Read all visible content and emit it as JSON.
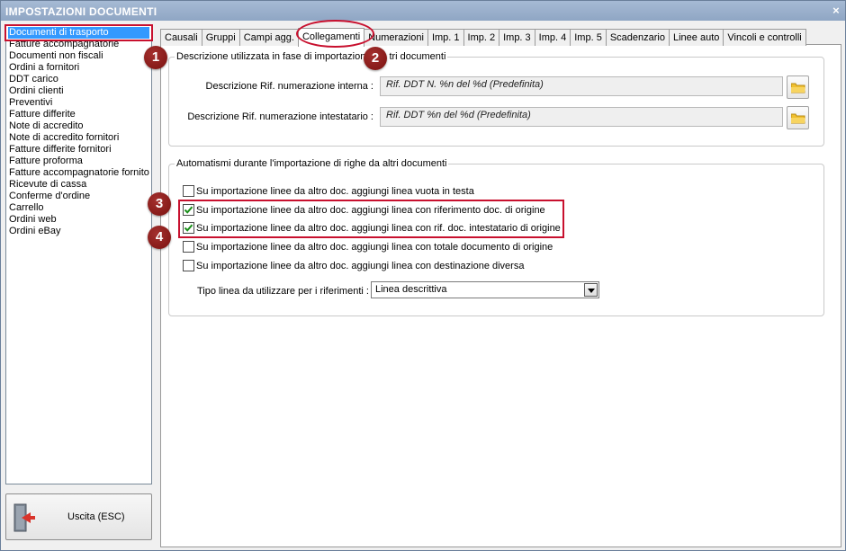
{
  "window": {
    "title": "IMPOSTAZIONI DOCUMENTI",
    "close": "×"
  },
  "sidebar": {
    "items": [
      "Documenti di trasporto",
      "Fatture accompagnatorie",
      "Documenti non fiscali",
      "Ordini a fornitori",
      "DDT carico",
      "Ordini clienti",
      "Preventivi",
      "Fatture differite",
      "Note di accredito",
      "Note di accredito fornitori",
      "Fatture differite fornitori",
      "Fatture proforma",
      "Fatture accompagnatorie fornito",
      "Ricevute di cassa",
      "Conferme d'ordine",
      "Carrello",
      "Ordini web",
      "Ordini eBay"
    ],
    "selected_index": 0
  },
  "exit": {
    "label": "Uscita (ESC)"
  },
  "tabs": [
    "Causali",
    "Gruppi",
    "Campi agg.",
    "Collegamenti",
    "Numerazioni",
    "Imp. 1",
    "Imp. 2",
    "Imp. 3",
    "Imp. 4",
    "Imp. 5",
    "Scadenzario",
    "Linee auto",
    "Vincoli e controlli"
  ],
  "active_tab": "Collegamenti",
  "markers": [
    "1",
    "2",
    "3",
    "4"
  ],
  "group_descr": {
    "title": "Descrizione utilizzata in fase di importazione",
    "title_tail": "tri documenti",
    "rows": [
      {
        "label": "Descrizione Rif. numerazione interna :",
        "value": "Rif. DDT N. %n del %d (Predefinita)"
      },
      {
        "label": "Descrizione Rif. numerazione intestatario :",
        "value": "Rif. DDT %n del %d (Predefinita)"
      }
    ]
  },
  "group_auto": {
    "title": "Automatismi durante l'importazione di righe da altri documenti",
    "checks": [
      {
        "label": "Su importazione linee da altro doc. aggiungi linea vuota in testa",
        "checked": false
      },
      {
        "label": "Su importazione linee da altro doc. aggiungi linea con riferimento doc. di origine",
        "checked": true
      },
      {
        "label": "Su importazione linee da altro doc. aggiungi linea con rif. doc. intestatario di origine",
        "checked": true
      },
      {
        "label": "Su importazione linee da altro doc. aggiungi linea con totale documento di origine",
        "checked": false
      },
      {
        "label": "Su importazione linee da altro doc. aggiungi linea con destinazione diversa",
        "checked": false
      }
    ],
    "select_label": "Tipo linea da utilizzare per i riferimenti :",
    "select_value": "Linea descrittiva"
  },
  "colors": {
    "highlight": "#c8102e",
    "selection": "#3399ff",
    "marker": "#8b1a18"
  }
}
